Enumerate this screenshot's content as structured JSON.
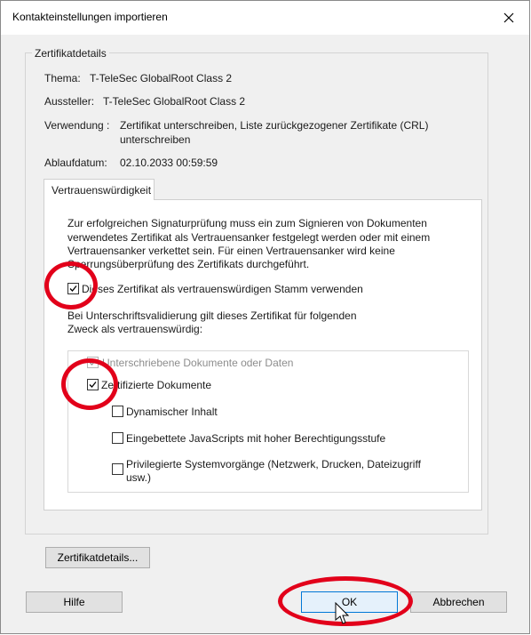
{
  "dialog": {
    "title": "Kontakteinstellungen importieren",
    "group_label": "Zertifikatdetails",
    "subject_label": "Thema:",
    "subject_value": "T-TeleSec GlobalRoot Class 2",
    "issuer_label": "Aussteller:",
    "issuer_value": "T-TeleSec GlobalRoot Class 2",
    "usage_label": "Verwendung :",
    "usage_line1": "Zertifikat unterschreiben, Liste zurückgezogener Zertifikate (CRL)",
    "usage_line2": "unterschreiben",
    "expiry_label": "Ablaufdatum:",
    "expiry_value": "02.10.2033 00:59:59",
    "tab_label": "Vertrauenswürdigkeit",
    "intro_line1": "Zur erfolgreichen Signaturprüfung muss ein zum Signieren von Dokumenten",
    "intro_line2": "verwendetes Zertifikat als Vertrauensanker festgelegt werden oder mit einem",
    "intro_line3": "Vertrauensanker verkettet sein. Für einen Vertrauensanker wird keine",
    "intro_line4": "Sperrungsüberprüfung des Zertifikats durchgeführt.",
    "trusted_root_label": "Dieses Zertifikat als vertrauenswürdigen Stamm verwenden",
    "purpose_line1": "Bei Unterschriftsvalidierung gilt dieses Zertifikat für folgenden",
    "purpose_line2": "Zweck als vertrauenswürdig:",
    "signed_docs_label": "Unterschriebene Dokumente oder Daten",
    "certified_docs_label": "Zertifizierte Dokumente",
    "dynamic_content_label": "Dynamischer Inhalt",
    "embedded_js_label": "Eingebettete JavaScripts mit hoher Berechtigungsstufe",
    "privileged_line1": "Privilegierte Systemvorgänge (Netzwerk, Drucken, Dateizugriff",
    "privileged_line2": "usw.)",
    "details_button": "Zertifikatdetails...",
    "help_button": "Hilfe",
    "ok_button": "OK",
    "cancel_button": "Abbrechen"
  },
  "checkbox_states": {
    "trusted_root": true,
    "signed_docs": true,
    "certified_docs": true,
    "dynamic_content": false,
    "embedded_js": false,
    "privileged": false
  },
  "colors": {
    "annotation_ring": "#e2001a",
    "ok_border": "#0078d7",
    "dialog_bg": "#f0f0f0"
  }
}
